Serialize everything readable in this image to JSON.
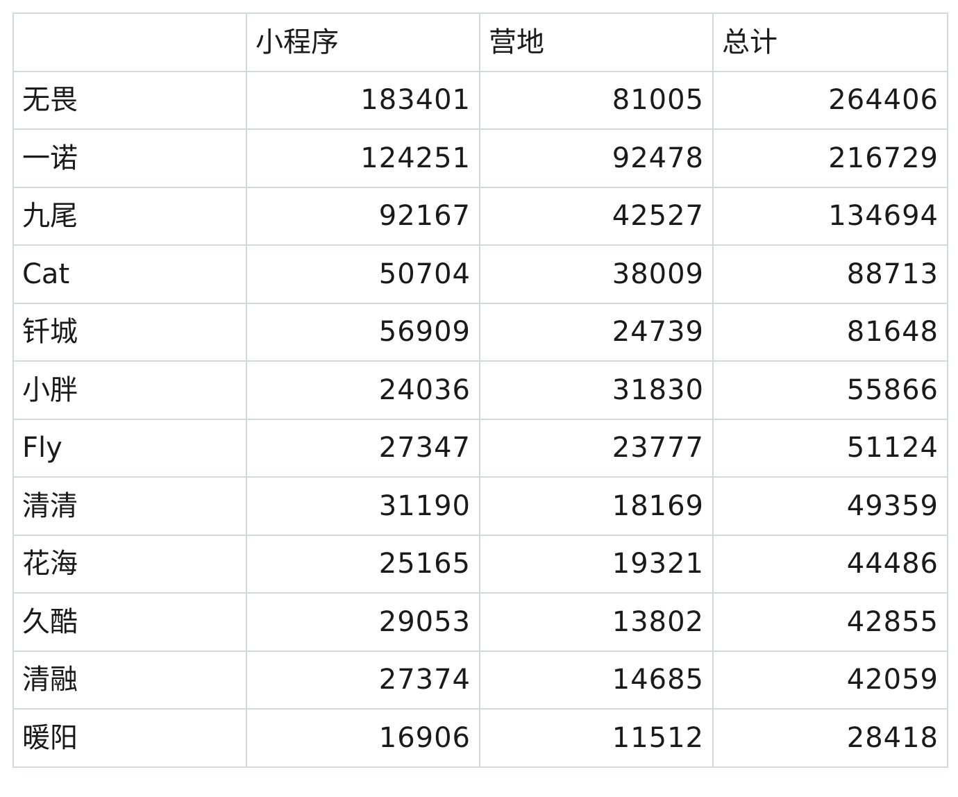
{
  "table": {
    "headers": [
      "",
      "小程序",
      "营地",
      "总计"
    ],
    "rows": [
      {
        "name": "无畏",
        "miniprogram": "183401",
        "camp": "81005",
        "total": "264406"
      },
      {
        "name": "一诺",
        "miniprogram": "124251",
        "camp": "92478",
        "total": "216729"
      },
      {
        "name": "九尾",
        "miniprogram": "92167",
        "camp": "42527",
        "total": "134694"
      },
      {
        "name": "Cat",
        "miniprogram": "50704",
        "camp": "38009",
        "total": "88713"
      },
      {
        "name": "钎城",
        "miniprogram": "56909",
        "camp": "24739",
        "total": "81648"
      },
      {
        "name": "小胖",
        "miniprogram": "24036",
        "camp": "31830",
        "total": "55866"
      },
      {
        "name": "Fly",
        "miniprogram": "27347",
        "camp": "23777",
        "total": "51124"
      },
      {
        "name": "清清",
        "miniprogram": "31190",
        "camp": "18169",
        "total": "49359"
      },
      {
        "name": "花海",
        "miniprogram": "25165",
        "camp": "19321",
        "total": "44486"
      },
      {
        "name": "久酷",
        "miniprogram": "29053",
        "camp": "13802",
        "total": "42855"
      },
      {
        "name": "清融",
        "miniprogram": "27374",
        "camp": "14685",
        "total": "42059"
      },
      {
        "name": "暖阳",
        "miniprogram": "16906",
        "camp": "11512",
        "total": "28418"
      }
    ]
  },
  "colors": {
    "border": "#d4d7dc",
    "text": "#1a1a1a",
    "background": "#ffffff"
  }
}
